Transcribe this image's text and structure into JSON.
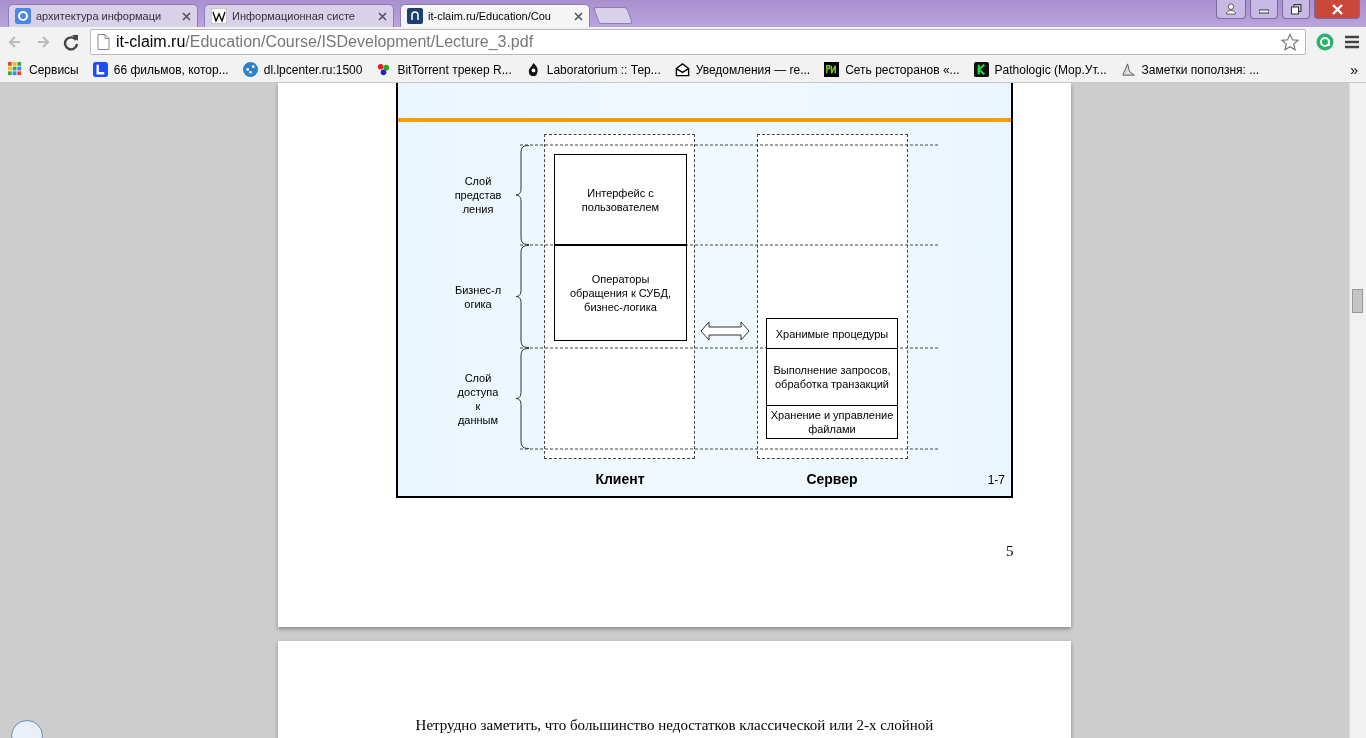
{
  "tabs": [
    {
      "title": "архитектура информаци",
      "selected": false
    },
    {
      "title": "Информационная систе",
      "selected": false
    },
    {
      "title": "it-claim.ru/Education/Cou",
      "selected": true
    }
  ],
  "address": {
    "host": "it-claim.ru",
    "path": "/Education/Course/ISDevelopment/Lecture_3.pdf"
  },
  "bookmarks": [
    {
      "label": "Сервисы"
    },
    {
      "label": "66 фильмов, котор..."
    },
    {
      "label": "dl.lpcenter.ru:1500"
    },
    {
      "label": "BitTorrent трекер R..."
    },
    {
      "label": "Laboratorium :: Тер..."
    },
    {
      "label": "Уведомления — re..."
    },
    {
      "label": "Сеть ресторанов «..."
    },
    {
      "label": "Pathologic (Мор.Ут..."
    },
    {
      "label": "Заметки поползня: ..."
    }
  ],
  "bookmarks_overflow": "»",
  "slide": {
    "layers": [
      "Слой\nпредстав\nления",
      "Бизнес-л\nогика",
      "Слой\nдоступа\nк\nданным"
    ],
    "client_boxes": [
      "Интерфейс с\nпользователем",
      "Операторы\nобращения к СУБД,\nбизнес-логика"
    ],
    "server_boxes": [
      "Хранимые процедуры",
      "Выполнение запросов,\nобработка транзакций",
      "Хранение и управление\nфайлами"
    ],
    "columns": [
      "Клиент",
      "Сервер"
    ],
    "slide_number": "1-7"
  },
  "page_number": "5",
  "next_page_text": "Нетрудно заметить, что большинство недостатков классической или 2-х слойной"
}
